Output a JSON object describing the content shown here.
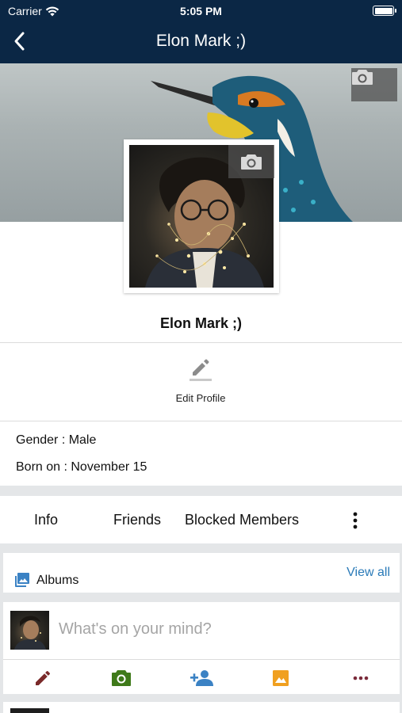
{
  "status_bar": {
    "carrier": "Carrier",
    "time": "5:05 PM"
  },
  "nav": {
    "title": "Elon Mark ;)"
  },
  "profile": {
    "name": "Elon Mark ;)",
    "edit_label": "Edit Profile",
    "gender": "Gender : Male",
    "born": "Born on : November 15"
  },
  "tabs": [
    {
      "label": "Info"
    },
    {
      "label": "Friends"
    },
    {
      "label": "Blocked Members"
    }
  ],
  "albums": {
    "label": "Albums",
    "view_all": "View all"
  },
  "composer": {
    "placeholder": "What's on your mind?"
  },
  "actions": [
    {
      "icon": "pencil-icon",
      "color": "#7a2a2a"
    },
    {
      "icon": "camera-icon",
      "color": "#3f7a1a"
    },
    {
      "icon": "add-person-icon",
      "color": "#3b82c4"
    },
    {
      "icon": "image-icon",
      "color": "#f0a020"
    },
    {
      "icon": "more-horizontal-icon",
      "color": "#7a2a3a"
    }
  ],
  "colors": {
    "nav_bg": "#0b2745",
    "link": "#2a7ab8",
    "band": "#e4e6e8"
  }
}
